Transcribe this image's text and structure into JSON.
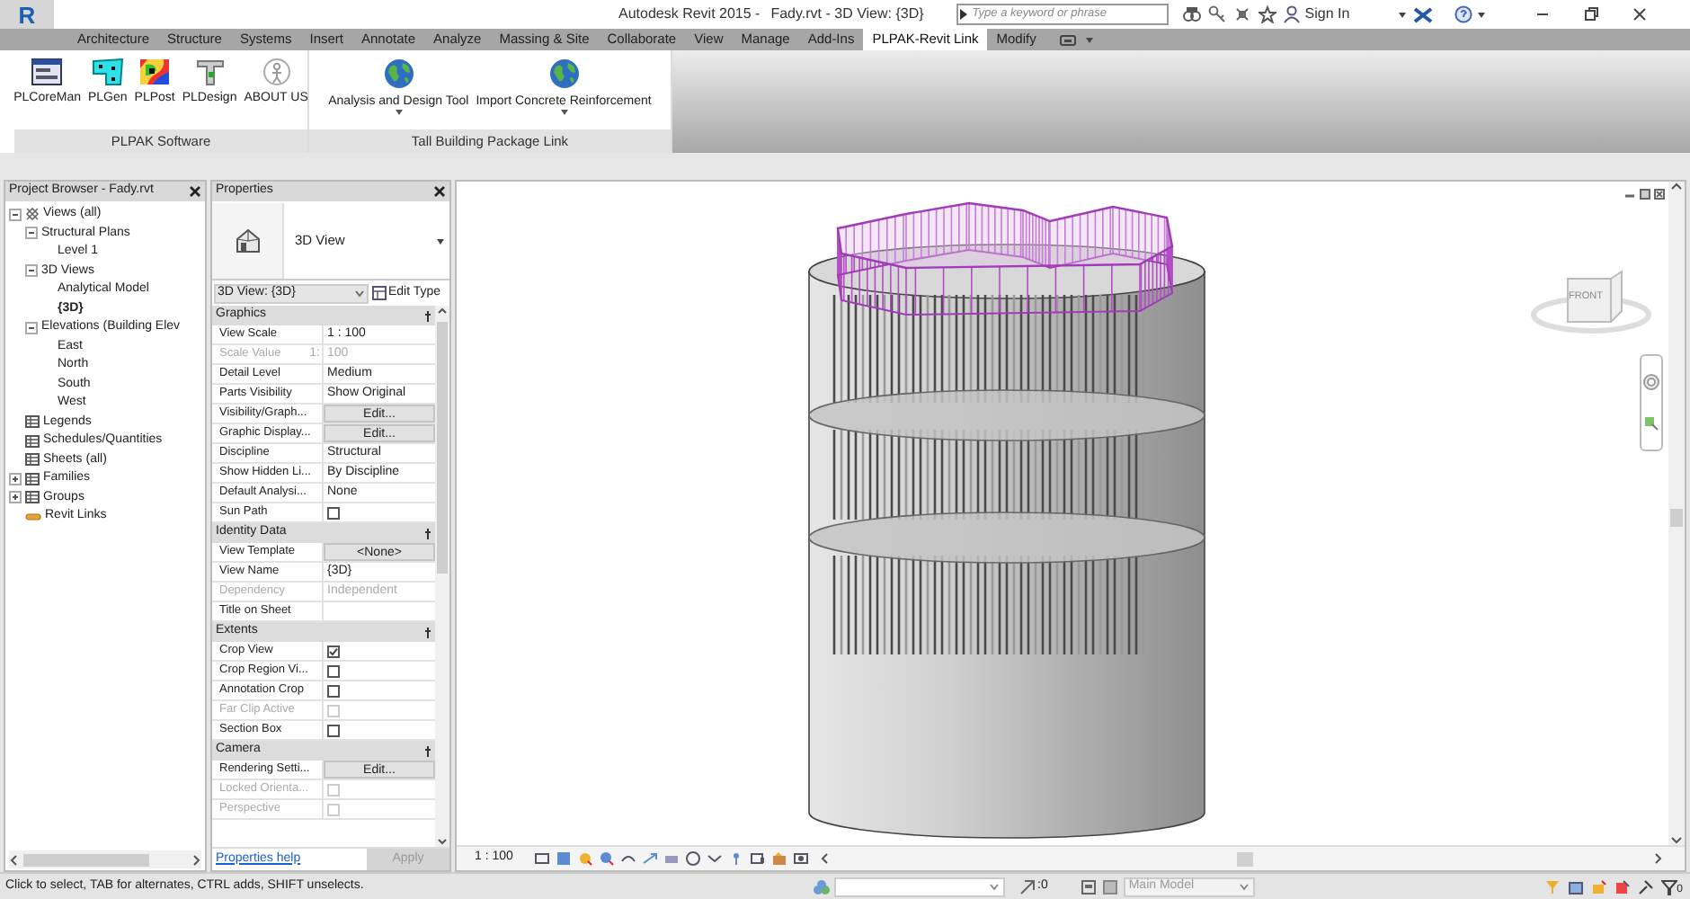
{
  "title_bar": {
    "app_logo": "R",
    "app_title": "Autodesk Revit 2015 -",
    "file_title": "Fady.rvt - 3D View: {3D}",
    "search": {
      "placeholder": "Type a keyword or phrase"
    },
    "sign_in": "Sign In"
  },
  "ribbon": {
    "tabs": [
      {
        "label": "Architecture",
        "selected": false
      },
      {
        "label": "Structure",
        "selected": false
      },
      {
        "label": "Systems",
        "selected": false
      },
      {
        "label": "Insert",
        "selected": false
      },
      {
        "label": "Annotate",
        "selected": false
      },
      {
        "label": "Analyze",
        "selected": false
      },
      {
        "label": "Massing & Site",
        "selected": false
      },
      {
        "label": "Collaborate",
        "selected": false
      },
      {
        "label": "View",
        "selected": false
      },
      {
        "label": "Manage",
        "selected": false
      },
      {
        "label": "Add-Ins",
        "selected": false
      },
      {
        "label": "PLPAK-Revit Link",
        "selected": true
      },
      {
        "label": "Modify",
        "selected": false
      }
    ],
    "panels": [
      {
        "title": "PLPAK Software",
        "buttons": [
          {
            "label": "PLCoreMan",
            "kind": "dialog"
          },
          {
            "label": "PLGen",
            "kind": "plate"
          },
          {
            "label": "PLPost",
            "kind": "contour"
          },
          {
            "label": "PLDesign",
            "kind": "column"
          },
          {
            "label": "ABOUT US",
            "kind": "person"
          }
        ]
      },
      {
        "title": "Tall Building Package Link",
        "buttons": [
          {
            "label": "Analysis and Design Tool",
            "kind": "globe",
            "dropdown": true
          },
          {
            "label": "Import Concrete Reinforcement",
            "kind": "globe",
            "dropdown": true
          }
        ]
      }
    ]
  },
  "project_browser": {
    "title": "Project Browser - Fady.rvt",
    "tree": [
      {
        "label": "Views (all)",
        "kind": "views",
        "expanded": true,
        "selected": false,
        "children": [
          {
            "label": "Structural Plans",
            "expanded": true,
            "selected": false,
            "children": [
              {
                "label": "Level 1",
                "selected": false
              }
            ]
          },
          {
            "label": "3D Views",
            "expanded": true,
            "selected": false,
            "children": [
              {
                "label": "Analytical Model",
                "selected": false
              },
              {
                "label": "{3D}",
                "selected": true
              }
            ]
          },
          {
            "label": "Elevations (Building Elev",
            "expanded": true,
            "selected": false,
            "children": [
              {
                "label": "East",
                "selected": false
              },
              {
                "label": "North",
                "selected": false
              },
              {
                "label": "South",
                "selected": false
              },
              {
                "label": "West",
                "selected": false
              }
            ]
          }
        ]
      },
      {
        "label": "Legends",
        "kind": "table",
        "selected": false
      },
      {
        "label": "Schedules/Quantities",
        "kind": "table",
        "selected": false
      },
      {
        "label": "Sheets (all)",
        "kind": "table",
        "selected": false
      },
      {
        "label": "Families",
        "kind": "table",
        "expanded": false,
        "selected": false
      },
      {
        "label": "Groups",
        "kind": "table",
        "expanded": false,
        "selected": false
      },
      {
        "label": "Revit Links",
        "kind": "link",
        "selected": false
      }
    ]
  },
  "properties": {
    "title": "Properties",
    "type_name": "3D View",
    "instance": "3D View: {3D}",
    "edit_type": "Edit Type",
    "rows": [
      {
        "kind": "section",
        "label": "Graphics"
      },
      {
        "kind": "text",
        "label": "View Scale",
        "value": "1 : 100",
        "disabled": false
      },
      {
        "kind": "text",
        "label": "Scale Value",
        "prefix": "1:",
        "value": "100",
        "disabled": true
      },
      {
        "kind": "text",
        "label": "Detail Level",
        "value": "Medium",
        "disabled": false
      },
      {
        "kind": "text",
        "label": "Parts Visibility",
        "value": "Show Original",
        "disabled": false
      },
      {
        "kind": "button",
        "label": "Visibility/Graph...",
        "value": "Edit...",
        "disabled": false
      },
      {
        "kind": "button",
        "label": "Graphic Display...",
        "value": "Edit...",
        "disabled": false
      },
      {
        "kind": "text",
        "label": "Discipline",
        "value": "Structural",
        "disabled": false
      },
      {
        "kind": "text",
        "label": "Show Hidden Li...",
        "value": "By Discipline",
        "disabled": false
      },
      {
        "kind": "text",
        "label": "Default Analysi...",
        "value": "None",
        "disabled": false
      },
      {
        "kind": "checkbox",
        "label": "Sun Path",
        "checked": false,
        "disabled": false
      },
      {
        "kind": "section",
        "label": "Identity Data"
      },
      {
        "kind": "button",
        "label": "View Template",
        "value": "<None>",
        "disabled": false
      },
      {
        "kind": "text",
        "label": "View Name",
        "value": "{3D}",
        "disabled": false
      },
      {
        "kind": "text",
        "label": "Dependency",
        "value": "Independent",
        "disabled": true
      },
      {
        "kind": "text",
        "label": "Title on Sheet",
        "disabled": false
      },
      {
        "kind": "section",
        "label": "Extents"
      },
      {
        "kind": "checkbox",
        "label": "Crop View",
        "checked": true,
        "disabled": false
      },
      {
        "kind": "checkbox",
        "label": "Crop Region Vi...",
        "checked": false,
        "disabled": false
      },
      {
        "kind": "checkbox",
        "label": "Annotation Crop",
        "checked": false,
        "disabled": false
      },
      {
        "kind": "checkbox",
        "label": "Far Clip Active",
        "checked": false,
        "disabled": true
      },
      {
        "kind": "checkbox",
        "label": "Section Box",
        "checked": false,
        "disabled": false
      },
      {
        "kind": "section",
        "label": "Camera"
      },
      {
        "kind": "button",
        "label": "Rendering Setti...",
        "value": "Edit...",
        "disabled": false
      },
      {
        "kind": "checkbox",
        "label": "Locked Orienta...",
        "checked": false,
        "disabled": true
      },
      {
        "kind": "checkbox",
        "label": "Perspective",
        "checked": false,
        "disabled": true
      }
    ],
    "help": "Properties help",
    "apply": {
      "label": "Apply",
      "disabled": true
    }
  },
  "view": {
    "viewcube_face": "FRONT",
    "scale": "1 : 100"
  },
  "status_bar": {
    "message": "Click to select, TAB for alternates, CTRL adds, SHIFT unselects.",
    "selection_count": ":0",
    "model": "Main Model",
    "filter_count": "0"
  }
}
